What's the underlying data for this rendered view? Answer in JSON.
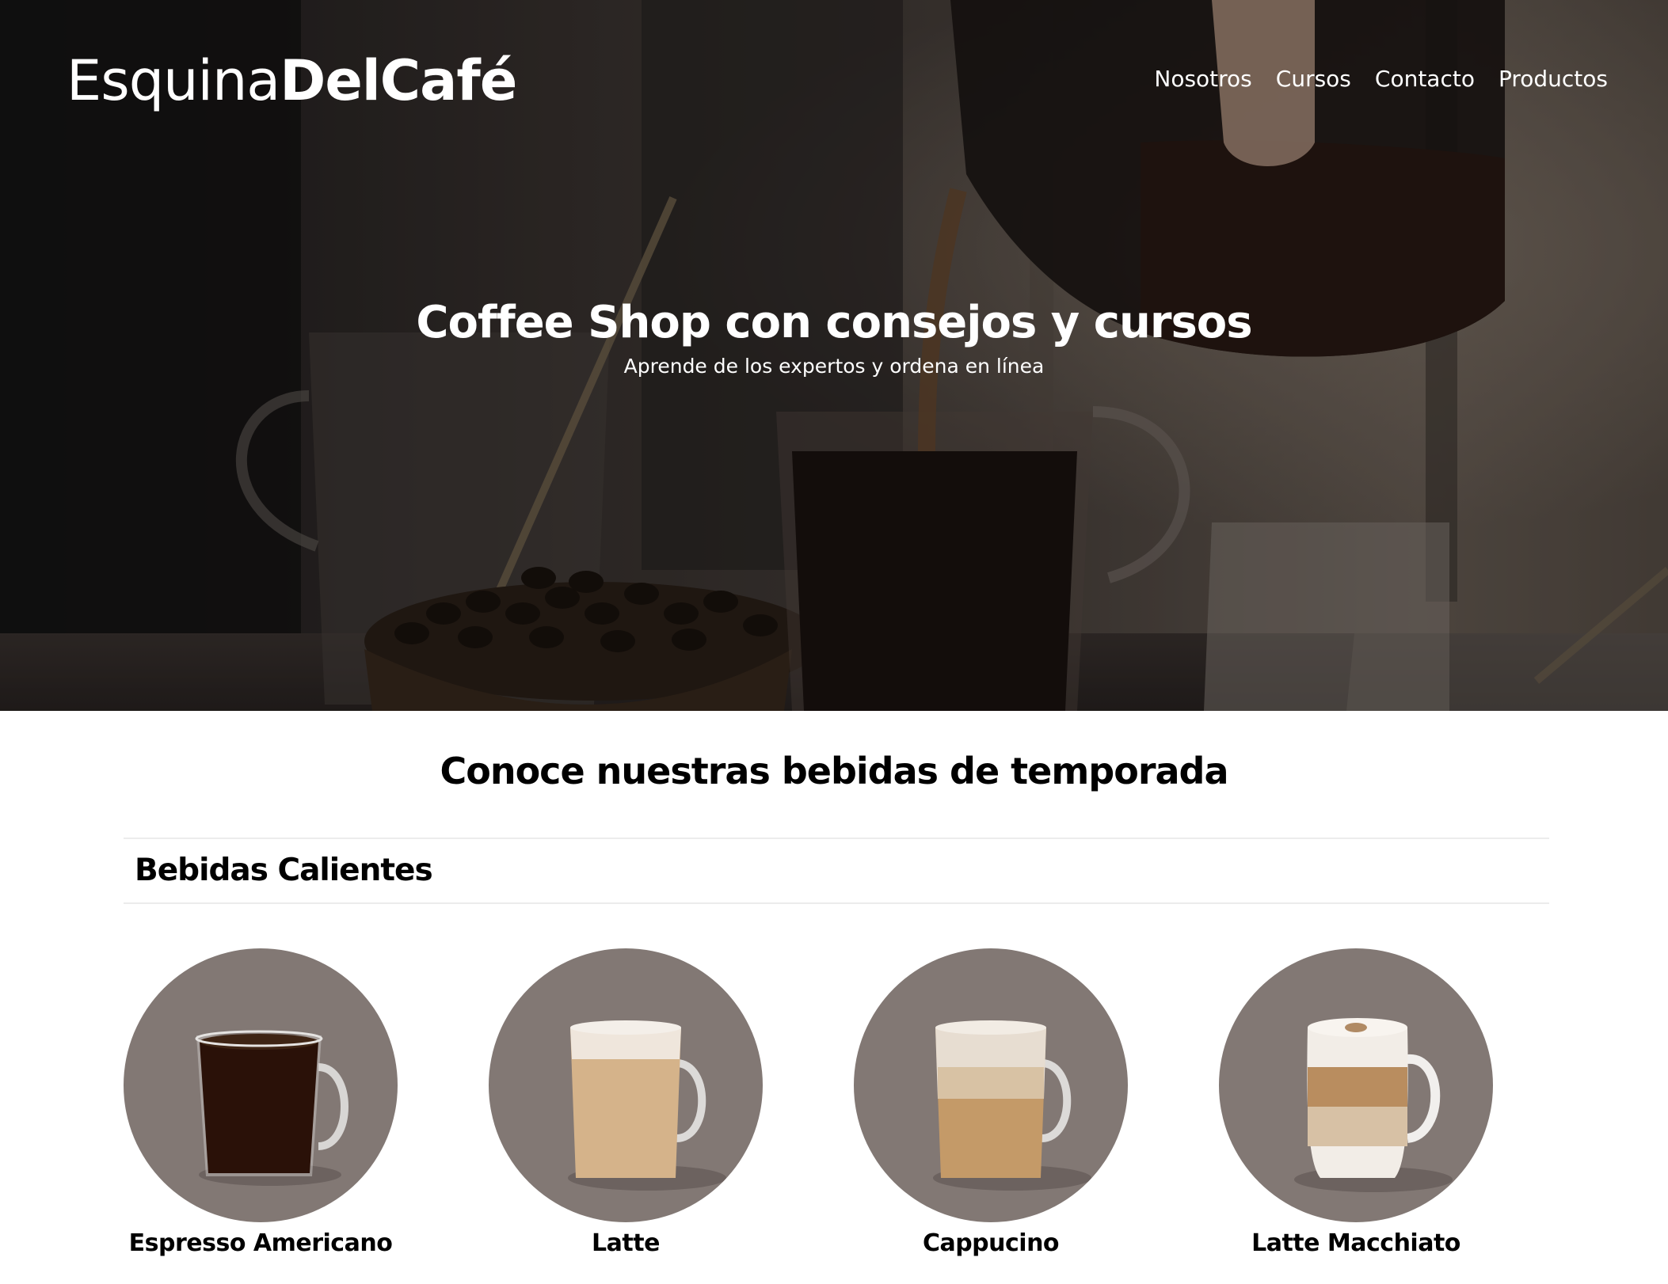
{
  "header": {
    "logo_light": "Esquina",
    "logo_bold": "DelCafé",
    "nav": [
      "Nosotros",
      "Cursos",
      "Contacto",
      "Productos"
    ]
  },
  "hero": {
    "title": "Coffee Shop con consejos y cursos",
    "subtitle": "Aprende de los expertos y ordena en línea"
  },
  "section": {
    "title": "Conoce nuestras bebidas de temporada",
    "category": "Bebidas Calientes"
  },
  "products": [
    {
      "name": "Espresso Americano",
      "icon": "espresso-americano-mug"
    },
    {
      "name": "Latte",
      "icon": "latte-mug"
    },
    {
      "name": "Cappucino",
      "icon": "cappucino-mug"
    },
    {
      "name": "Latte Macchiato",
      "icon": "latte-macchiato-mug"
    }
  ],
  "colors": {
    "circle_bg": "#827874",
    "text": "#000000",
    "hero_text": "#ffffff"
  }
}
